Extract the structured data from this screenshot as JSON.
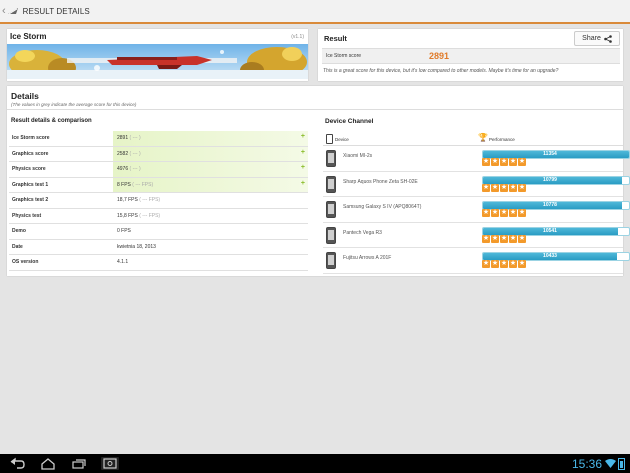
{
  "topbar": {
    "title": "RESULT DETAILS"
  },
  "ice_storm": {
    "title": "Ice Storm",
    "version": "(v1.1)"
  },
  "result": {
    "title": "Result",
    "share_label": "Share",
    "score_label": "Ice Storm score",
    "score_value": "2891",
    "message": "This is a great score for this device, but it's low compared to other models. Maybe it's time for an upgrade?"
  },
  "details": {
    "title": "Details",
    "subtitle": "(The values in grey indicate the average score for this device)",
    "comparison_title": "Result details & comparison",
    "rows": [
      {
        "label": "Ice Storm score",
        "value": "2891",
        "avg": "( --- )",
        "highlight": true
      },
      {
        "label": "Graphics score",
        "value": "2582",
        "avg": "( --- )",
        "highlight": true
      },
      {
        "label": "Physics score",
        "value": "4976",
        "avg": "( --- )",
        "highlight": true
      },
      {
        "label": "Graphics test 1",
        "value": "8 FPS",
        "avg": "( --- FPS)",
        "highlight": true
      },
      {
        "label": "Graphics test 2",
        "value": "18,7 FPS",
        "avg": "( --- FPS)",
        "highlight": false
      },
      {
        "label": "Physics test",
        "value": "15,8 FPS",
        "avg": "( --- FPS)",
        "highlight": false
      },
      {
        "label": "Demo",
        "value": "0 FPS",
        "avg": "",
        "highlight": false
      },
      {
        "label": "Date",
        "value": "kwietnia 18, 2013",
        "avg": "",
        "highlight": false
      },
      {
        "label": "OS version",
        "value": "4.1.1",
        "avg": "",
        "highlight": false
      }
    ]
  },
  "device_channel": {
    "title": "Device Channel",
    "col_device": "Device",
    "col_performance": "Performance",
    "max_score": 11354,
    "devices": [
      {
        "name": "Xiaomi MI-2s",
        "score": "11354",
        "score_num": 11354,
        "stars": 5
      },
      {
        "name": "Sharp Aquos Phone Zeta SH-02E",
        "score": "10799",
        "score_num": 10799,
        "stars": 5
      },
      {
        "name": "Samsung Galaxy S IV (APQ8064T)",
        "score": "10778",
        "score_num": 10778,
        "stars": 5
      },
      {
        "name": "Pantech Vega R3",
        "score": "10541",
        "score_num": 10541,
        "stars": 5
      },
      {
        "name": "Fujitsu Arrows A 201F",
        "score": "10433",
        "score_num": 10433,
        "stars": 5
      }
    ]
  },
  "statusbar": {
    "time": "15:36"
  },
  "colors": {
    "accent": "#e07b2a",
    "bar": "#2a9cc3",
    "star": "#f39a2b",
    "clock": "#4ab7e8"
  },
  "icons": [
    "back-chevron-icon",
    "3dmark-logo-icon",
    "share-icon",
    "phone-icon",
    "trophy-icon",
    "star-icon",
    "nav-back-icon",
    "nav-home-icon",
    "nav-recent-icon",
    "screenshot-icon",
    "wifi-icon",
    "battery-icon"
  ]
}
